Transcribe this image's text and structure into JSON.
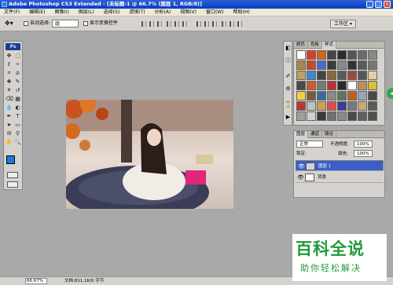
{
  "window": {
    "title": "Adobe Photoshop CS3 Extended - [未标题-1 @ 66.7% (图层 1, RGB/8)]",
    "controls": [
      "_",
      "□",
      "×"
    ]
  },
  "menubar": {
    "items": [
      "文件(F)",
      "编辑(E)",
      "图像(I)",
      "图层(L)",
      "选择(S)",
      "滤镜(T)",
      "分析(A)",
      "视图(V)",
      "窗口(W)",
      "帮助(H)"
    ]
  },
  "options_bar": {
    "auto_select_label": "自动选择:",
    "auto_select_value": "组",
    "show_transform_label": "显示变换控件",
    "workspace_label": "工作区 ▾"
  },
  "toolbox": {
    "logo": "Ps",
    "tools": [
      "move-tool-icon",
      "marquee-tool-icon",
      "lasso-tool-icon",
      "magic-wand-icon",
      "crop-tool-icon",
      "slice-tool-icon",
      "healing-brush-icon",
      "brush-tool-icon",
      "clone-stamp-icon",
      "history-brush-icon",
      "eraser-icon",
      "gradient-tool-icon",
      "blur-tool-icon",
      "dodge-tool-icon",
      "pen-tool-icon",
      "type-tool-icon",
      "path-select-icon",
      "shape-tool-icon",
      "notes-tool-icon",
      "eyedropper-icon",
      "hand-tool-icon",
      "zoom-tool-icon"
    ],
    "glyphs": [
      "✥",
      "⬚",
      "ℓ",
      "✧",
      "⌗",
      "⧄",
      "✚",
      "✎",
      "⚘",
      "↺",
      "⌫",
      "▦",
      "💧",
      "◐",
      "✒",
      "T",
      "➤",
      "▭",
      "✉",
      "⚲",
      "✋",
      "🔍"
    ],
    "fg_color": "#1e78d9",
    "bg_color": "#ffffff"
  },
  "styles_panel": {
    "tabs": [
      "颜色",
      "色板",
      "样式"
    ],
    "active_tab": "样式",
    "swatch_colors": [
      "#ffffff",
      "#e03a2a",
      "#d9621a",
      "#444444",
      "#2a2a2a",
      "#555555",
      "#6a6a6a",
      "#888888",
      "#a8874a",
      "#c44a2a",
      "#4a6ad0",
      "#3a3a3a",
      "#888888",
      "#333333",
      "#5a5a5a",
      "#777777",
      "#c0a060",
      "#3a8ad0",
      "#444444",
      "#8a6a3a",
      "#5a5a5a",
      "#9a4a3a",
      "#555555",
      "#e0d0a0",
      "#4a4a4a",
      "#d45a2a",
      "#7a7a7a",
      "#c03030",
      "#2a2a2a",
      "#ffffff",
      "#b89060",
      "#d8c030",
      "#f0d040",
      "#7a5a3a",
      "#3a6aa0",
      "#8a8a8a",
      "#5a7a5a",
      "#c06020",
      "#9aa6b0",
      "#4a4a4a",
      "#b03a3a",
      "#c0c0c0",
      "#d0a050",
      "#e04a4a",
      "#3a3a9a",
      "#7a7a7a",
      "#c8a878",
      "#5a5a5a",
      "#a0a0a0",
      "#d0d0d0",
      "#3a3a3a",
      "#707070",
      "#8a8a8a",
      "#4a4a4a",
      "#606060",
      "#505050"
    ]
  },
  "layers_panel": {
    "tabs": [
      "图层",
      "通道",
      "路径"
    ],
    "blend_mode": "正常",
    "opacity_label": "不透明度:",
    "opacity_value": "100%",
    "lock_label": "锁定:",
    "fill_label": "填充:",
    "fill_value": "100%",
    "layers": [
      {
        "name": "图层 1",
        "selected": true
      },
      {
        "name": "背景",
        "selected": false
      }
    ]
  },
  "statusbar": {
    "zoom": "66.67%",
    "doc_info": "文档:811.1K/0 字节"
  },
  "watermark": {
    "title": "百科全说",
    "subtitle": "助你轻松解决"
  }
}
